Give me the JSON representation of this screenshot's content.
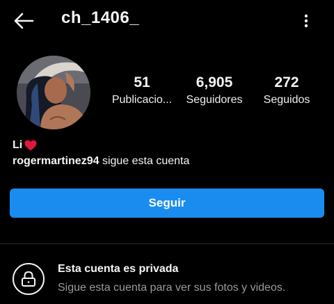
{
  "header": {
    "username": "ch_1406_",
    "back_icon": "arrow-left-icon",
    "more_icon": "more-vertical-icon"
  },
  "profile": {
    "avatar": "profile-photo",
    "stats": {
      "posts": {
        "value": "51",
        "label": "Publicacio..."
      },
      "followers": {
        "value": "6,905",
        "label": "Seguidores"
      },
      "following": {
        "value": "272",
        "label": "Seguidos"
      }
    },
    "bio_name": "Li",
    "bio_emoji": "red-heart-icon",
    "followed_by_user": "rogermartinez94",
    "followed_by_text": "sigue esta cuenta"
  },
  "actions": {
    "follow_label": "Seguir"
  },
  "private": {
    "icon": "lock-icon",
    "title": "Esta cuenta es privada",
    "subtitle": "Sigue esta cuenta para ver sus fotos y videos."
  },
  "colors": {
    "accent": "#1a8cf0",
    "background": "#000000",
    "heart": "#e0163c"
  }
}
